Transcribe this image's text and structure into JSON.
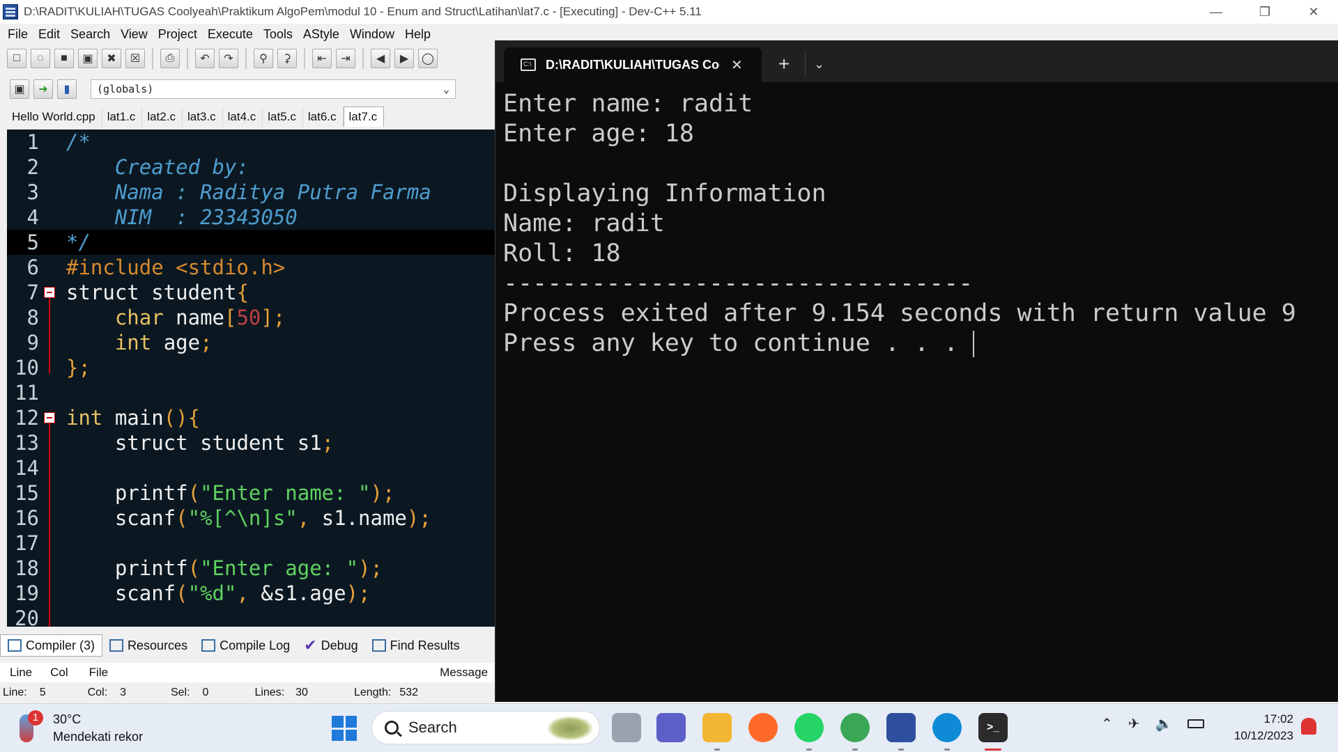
{
  "devcpp": {
    "title": "D:\\RADIT\\KULIAH\\TUGAS Coolyeah\\Praktikum AlgoPem\\modul 10 - Enum and Struct\\Latihan\\lat7.c - [Executing] - Dev-C++ 5.11",
    "menu": [
      "File",
      "Edit",
      "Search",
      "View",
      "Project",
      "Execute",
      "Tools",
      "AStyle",
      "Window",
      "Help"
    ],
    "scope_select": "(globals)",
    "file_tabs": [
      "Hello World.cpp",
      "lat1.c",
      "lat2.c",
      "lat3.c",
      "lat4.c",
      "lat5.c",
      "lat6.c",
      "lat7.c"
    ],
    "active_file_tab": "lat7.c",
    "bottom_tabs": [
      "Compiler (3)",
      "Resources",
      "Compile Log",
      "Debug",
      "Find Results"
    ],
    "log_columns": [
      "Line",
      "Col",
      "File",
      "Message"
    ],
    "status": {
      "line_label": "Line:",
      "line": "5",
      "col_label": "Col:",
      "col": "3",
      "sel_label": "Sel:",
      "sel": "0",
      "lines_label": "Lines:",
      "lines": "30",
      "length_label": "Length:",
      "length": "532"
    },
    "code_lines": [
      {
        "n": "1",
        "tokens": [
          [
            "c-cm",
            "/*"
          ]
        ]
      },
      {
        "n": "2",
        "tokens": [
          [
            "c-cm",
            "    Created by:"
          ]
        ]
      },
      {
        "n": "3",
        "tokens": [
          [
            "c-cm",
            "    Nama : Raditya Putra Farma"
          ]
        ]
      },
      {
        "n": "4",
        "tokens": [
          [
            "c-cm",
            "    NIM  : 23343050"
          ]
        ]
      },
      {
        "n": "5",
        "tokens": [
          [
            "c-cm",
            "*/"
          ]
        ]
      },
      {
        "n": "6",
        "tokens": [
          [
            "c-pp",
            "#include <stdio.h>"
          ]
        ]
      },
      {
        "n": "7",
        "tokens": [
          [
            "c-kw",
            "struct "
          ],
          [
            "c-tx",
            "student"
          ],
          [
            "c-sy",
            "{"
          ]
        ]
      },
      {
        "n": "8",
        "tokens": [
          [
            "c-tx",
            "    "
          ],
          [
            "c-ty",
            "char "
          ],
          [
            "c-tx",
            "name"
          ],
          [
            "c-sy",
            "["
          ],
          [
            "c-nu",
            "50"
          ],
          [
            "c-sy",
            "];"
          ]
        ]
      },
      {
        "n": "9",
        "tokens": [
          [
            "c-tx",
            "    "
          ],
          [
            "c-ty",
            "int "
          ],
          [
            "c-tx",
            "age"
          ],
          [
            "c-sy",
            ";"
          ]
        ]
      },
      {
        "n": "10",
        "tokens": [
          [
            "c-sy",
            "};"
          ]
        ]
      },
      {
        "n": "11",
        "tokens": []
      },
      {
        "n": "12",
        "tokens": [
          [
            "c-ty",
            "int "
          ],
          [
            "c-tx",
            "main"
          ],
          [
            "c-sy",
            "(){"
          ]
        ]
      },
      {
        "n": "13",
        "tokens": [
          [
            "c-tx",
            "    "
          ],
          [
            "c-kw",
            "struct "
          ],
          [
            "c-tx",
            "student s1"
          ],
          [
            "c-sy",
            ";"
          ]
        ]
      },
      {
        "n": "14",
        "tokens": []
      },
      {
        "n": "15",
        "tokens": [
          [
            "c-tx",
            "    printf"
          ],
          [
            "c-sy",
            "("
          ],
          [
            "c-st",
            "\"Enter name: \""
          ],
          [
            "c-sy",
            ");"
          ]
        ]
      },
      {
        "n": "16",
        "tokens": [
          [
            "c-tx",
            "    scanf"
          ],
          [
            "c-sy",
            "("
          ],
          [
            "c-st",
            "\"%[^\\n]s\""
          ],
          [
            "c-sy",
            ", "
          ],
          [
            "c-tx",
            "s1.name"
          ],
          [
            "c-sy",
            ");"
          ]
        ]
      },
      {
        "n": "17",
        "tokens": []
      },
      {
        "n": "18",
        "tokens": [
          [
            "c-tx",
            "    printf"
          ],
          [
            "c-sy",
            "("
          ],
          [
            "c-st",
            "\"Enter age: \""
          ],
          [
            "c-sy",
            ");"
          ]
        ]
      },
      {
        "n": "19",
        "tokens": [
          [
            "c-tx",
            "    scanf"
          ],
          [
            "c-sy",
            "("
          ],
          [
            "c-st",
            "\"%d\""
          ],
          [
            "c-sy",
            ", "
          ],
          [
            "c-tx",
            "&s1.age"
          ],
          [
            "c-sy",
            ");"
          ]
        ]
      },
      {
        "n": "20",
        "tokens": []
      }
    ]
  },
  "terminal": {
    "tab_title": "D:\\RADIT\\KULIAH\\TUGAS Coc",
    "output_lines": [
      "Enter name: radit",
      "Enter age: 18",
      "",
      "Displaying Information",
      "Name: radit",
      "Roll: 18",
      "--------------------------------",
      "Process exited after 9.154 seconds with return value 9",
      "Press any key to continue . . . "
    ]
  },
  "taskbar": {
    "weather_badge": "1",
    "temperature": "30°C",
    "weather_text": "Mendekati rekor",
    "search_placeholder": "Search",
    "time": "17:02",
    "date": "10/12/2023",
    "apps": [
      {
        "icon": "task-view-icon",
        "color": "#9aa3ad"
      },
      {
        "icon": "teams-chat-icon",
        "color": "#5b5fc7"
      },
      {
        "icon": "file-explorer-icon",
        "color": "#f2b632"
      },
      {
        "icon": "firefox-icon",
        "color": "#ff6a2b"
      },
      {
        "icon": "whatsapp-icon",
        "color": "#25d366"
      },
      {
        "icon": "chrome-icon",
        "color": "#3aa757"
      },
      {
        "icon": "devcpp-icon",
        "color": "#2d4f9e"
      },
      {
        "icon": "edge-icon",
        "color": "#0f8ad6"
      },
      {
        "icon": "terminal-icon",
        "color": "#2b2b2b"
      }
    ]
  }
}
